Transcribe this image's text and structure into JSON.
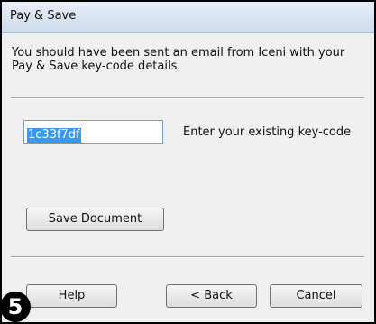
{
  "window": {
    "title": "Pay & Save"
  },
  "message": "You should have been sent an email from Iceni with your Pay & Save key-code details.",
  "keycode": {
    "value": "1c33f7df",
    "label": "Enter your existing key-code"
  },
  "buttons": {
    "save_document": "Save Document",
    "help": "Help",
    "back": "< Back",
    "cancel": "Cancel"
  },
  "step_badge": "5"
}
